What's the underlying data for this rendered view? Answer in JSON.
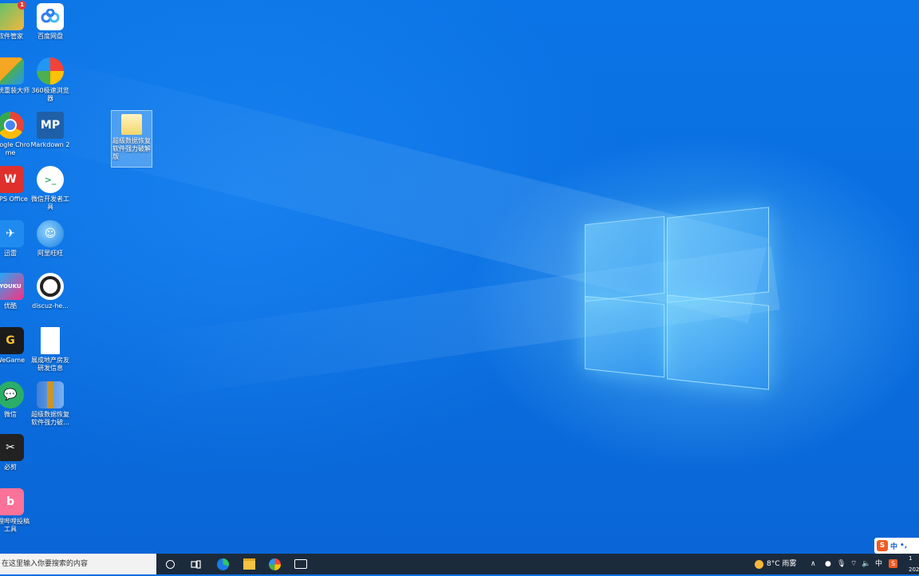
{
  "desktop": {
    "icons": [
      {
        "label": "软件管家",
        "icon": "app-manager-icon",
        "badge": "1"
      },
      {
        "label": "百度网盘",
        "icon": "baidu-netdisk-icon"
      },
      {
        "label": "系统重装大师",
        "icon": "system-reinstall-icon"
      },
      {
        "label": "360极速浏览器",
        "icon": "360-browser-icon"
      },
      {
        "label": "Google Chrome",
        "icon": "chrome-icon"
      },
      {
        "label": "Markdown 2",
        "icon": "markdownpad-icon",
        "short": "MP"
      },
      {
        "label": "WPS Office",
        "icon": "wps-icon"
      },
      {
        "label": "微信开发者工具",
        "icon": "wechat-devtools-icon"
      },
      {
        "label": "迅雷",
        "icon": "xunlei-icon"
      },
      {
        "label": "阿里旺旺",
        "icon": "aliwangwang-icon"
      },
      {
        "label": "优酷",
        "icon": "youku-icon",
        "short": "YOUKU"
      },
      {
        "label": "discuz-he...",
        "icon": "discuz-icon"
      },
      {
        "label": "WeGame",
        "icon": "wegame-icon"
      },
      {
        "label": "展成地产房友研发信息",
        "icon": "text-file-icon"
      },
      {
        "label": "微信",
        "icon": "wechat-icon"
      },
      {
        "label": "超级数据恢复软件强力破...",
        "icon": "winrar-archive-icon"
      },
      {
        "label": "必剪",
        "icon": "bijian-icon"
      },
      {
        "label": "哔哩哔哩投稿工具",
        "icon": "bilibili-upload-icon"
      }
    ],
    "selected_folder": {
      "label": "超级数据恢复软件强力破解版",
      "icon": "folder-icon"
    }
  },
  "taskbar": {
    "search_placeholder": "在这里输入你要搜索的内容",
    "apps": [
      {
        "name": "cortana-button",
        "icon": "cortana-circle-icon"
      },
      {
        "name": "task-view-button",
        "icon": "task-view-icon"
      },
      {
        "name": "edge-button",
        "icon": "edge-icon"
      },
      {
        "name": "file-explorer-button",
        "icon": "file-explorer-icon"
      },
      {
        "name": "360-browser-taskbar-button",
        "icon": "360-browser-icon"
      },
      {
        "name": "wps-taskbar-button",
        "icon": "app-taskbar-icon"
      }
    ],
    "weather": "8°C 雨雾",
    "ime_label": "中",
    "ime_bar_label": "中",
    "clock_partial": "1",
    "date_partial": "202"
  },
  "colors": {
    "wallpaper_blue": "#0a6fe0",
    "taskbar": "#1c2b3c",
    "window_glow": "#8ce1ff"
  }
}
